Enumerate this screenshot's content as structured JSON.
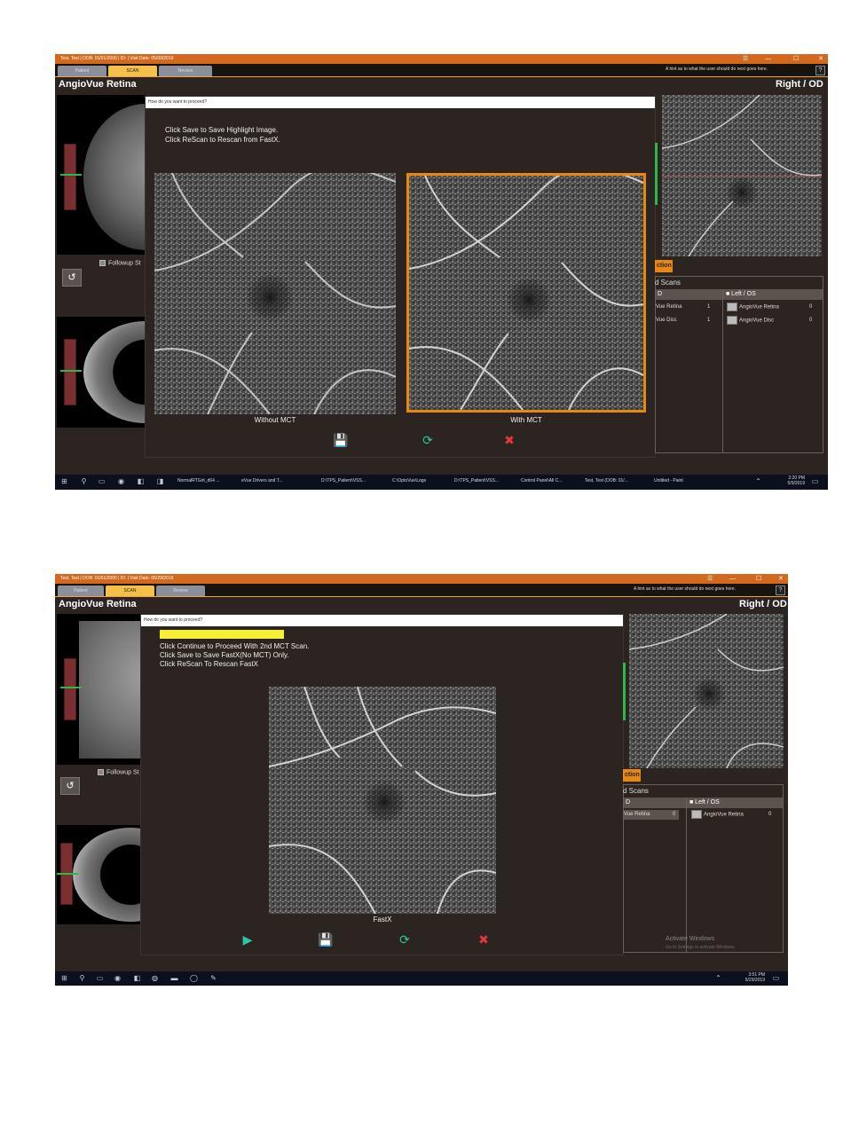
{
  "shot1": {
    "titlebar": "Test, Test  |  DOB: 01/01/2000  |  ID:  |  Visit Date: 05/09/2019",
    "tabs": {
      "first": "Patient",
      "scan": "SCAN",
      "third": "Review"
    },
    "tab_hint": "A hint as to what the user should do next goes here.",
    "app_title": "AngioVue Retina",
    "eye": "Right / OD",
    "followup": "Followup St",
    "dialog": {
      "title": "How do you want to proceed?",
      "line1": "Click Save to Save Highlight Image.",
      "line2": "Click ReScan to Rescan from FastX.",
      "label_left": "Without MCT",
      "label_right": "With MCT"
    },
    "action_header": "ction",
    "scans_title": "d Scans",
    "col_od": "D",
    "col_os": "■ Left / OS",
    "od_rows": [
      {
        "name": "Vue Retina",
        "count": "1"
      },
      {
        "name": "Vue Disc",
        "count": "1"
      }
    ],
    "os_rows": [
      {
        "name": "AngioVue Retina",
        "count": "0"
      },
      {
        "name": "AngioVue Disc",
        "count": "0"
      }
    ],
    "taskbar": [
      "NormalRTGrit_d64 ...",
      "eVue Drivers and T...",
      "D:\\TPS_Patient\\VSS...",
      "C:\\OptoVue\\Logs",
      "D:\\TPS_Patient\\VSS...",
      "Control Panel\\All C...",
      "Test, Test (DOB: 01/...",
      "Untitled - Paint"
    ],
    "clock_time": "2:20 PM",
    "clock_date": "5/9/2019"
  },
  "shot2": {
    "titlebar": "Test, Test  |  DOB: 01/01/2000  |  ID:  |  Visit Date: 05/29/2019",
    "tabs": {
      "first": "Patient",
      "scan": "SCAN",
      "third": "Review"
    },
    "tab_hint": "A hint as to what the user should do next goes here.",
    "app_title": "AngioVue Retina",
    "eye": "Right / OD",
    "followup": "Followup St",
    "dialog": {
      "title": "How do you want to proceed?",
      "line1": "Click Continue to Proceed With 2nd MCT Scan.",
      "line2": "Click Save to Save FastX(No MCT) Only.",
      "line3": "Click ReScan To Rescan FastX",
      "label": "FastX"
    },
    "action_header": "ction",
    "scans_title": "d Scans",
    "col_od": "D",
    "col_os": "■ Left / OS",
    "od_rows": [
      {
        "name": "Vue Retina",
        "count": "0"
      }
    ],
    "os_rows": [
      {
        "name": "AngioVue Retina",
        "count": "0"
      }
    ],
    "watermark": "Activate Windows",
    "watermark_sub": "Go to Settings to activate Windows.",
    "clock_time": "3:51 PM",
    "clock_date": "5/29/2019"
  },
  "icons": {
    "save": "💾",
    "rescan": "⟳",
    "cancel": "✖",
    "proceed": "▶",
    "refresh": "↺"
  }
}
